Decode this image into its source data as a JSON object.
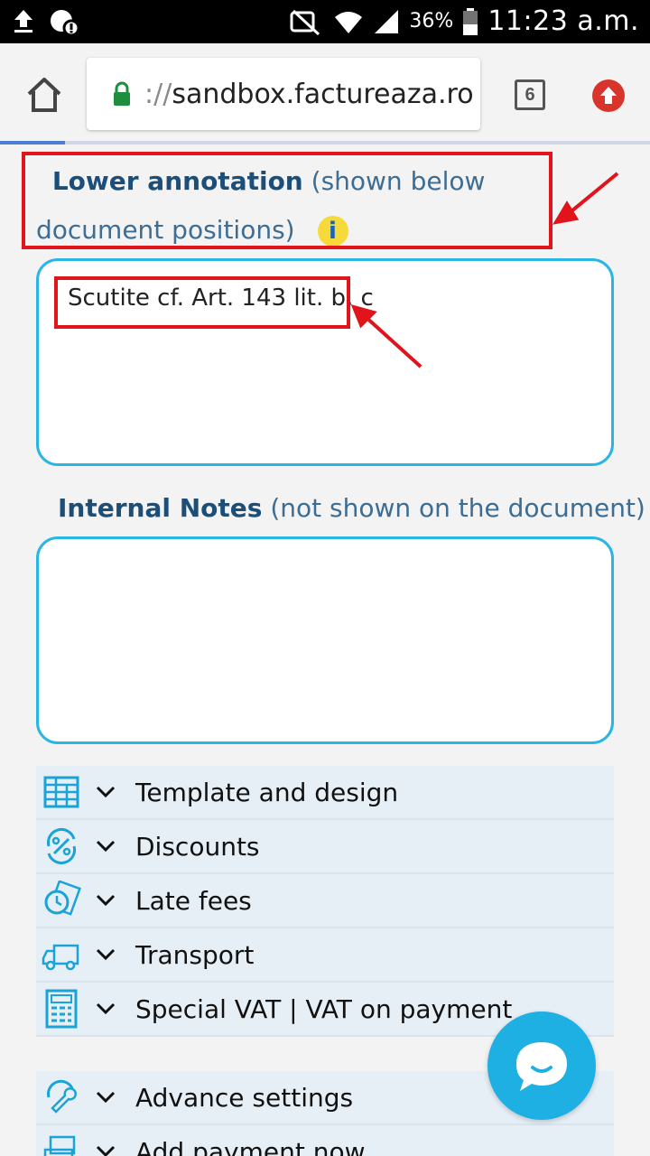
{
  "status_bar": {
    "battery_percent": "36%",
    "time": "11:23 a.m."
  },
  "browser": {
    "url_scheme": "://",
    "url_host": "sandbox.factureaza.ro",
    "tab_count": "6"
  },
  "form": {
    "lower_annotation": {
      "title": "Lower annotation",
      "hint": "(shown below document positions)",
      "value": "Scutite cf. Art. 143 lit. b, c"
    },
    "internal_notes": {
      "title": "Internal Notes",
      "hint": "(not shown on the document)",
      "value": ""
    }
  },
  "accordion": {
    "items": [
      {
        "label": "Template and design",
        "icon": "template-grid-icon"
      },
      {
        "label": "Discounts",
        "icon": "percent-icon"
      },
      {
        "label": "Late fees",
        "icon": "clock-money-icon"
      },
      {
        "label": "Transport",
        "icon": "truck-icon"
      },
      {
        "label": "Special VAT | VAT on payment",
        "icon": "calculator-icon"
      }
    ],
    "items2": [
      {
        "label": "Advance settings",
        "icon": "wrench-icon"
      },
      {
        "label": "Add payment now",
        "icon": "payment-icon"
      }
    ]
  },
  "colors": {
    "accent": "#29b6e6",
    "label_color": "#1b4f7a",
    "annotation_red": "#e0141a"
  }
}
